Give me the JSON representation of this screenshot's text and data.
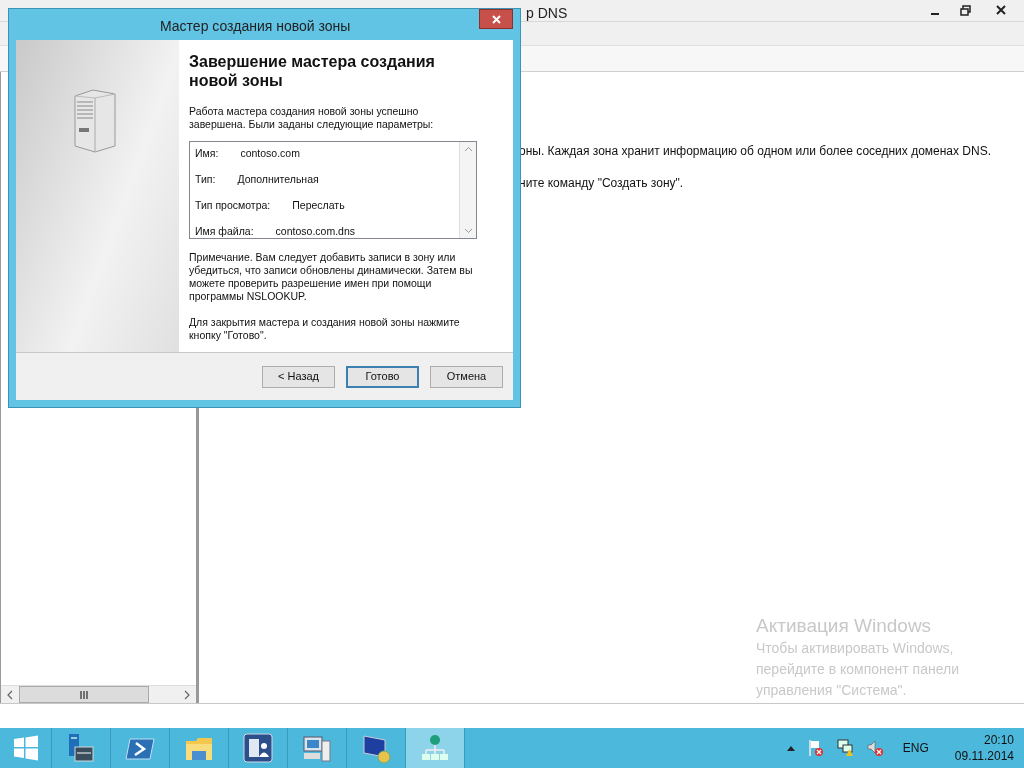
{
  "background_window": {
    "title": "р DNS",
    "description_lines": [
      "оны. Каждая зона хранит информацию об одном или более соседних доменах DNS.",
      "ните команду \"Создать зону\"."
    ]
  },
  "dialog": {
    "title": "Мастер создания новой зоны",
    "heading": "Завершение мастера создания новой зоны",
    "intro": "Работа мастера создания новой зоны успешно завершена. Были заданы следующие параметры:",
    "summary": [
      {
        "label": "Имя:",
        "value": "contoso.com"
      },
      {
        "label": "Тип:",
        "value": "Дополнительная"
      },
      {
        "label": "Тип просмотра:",
        "value": "Переслать"
      },
      {
        "label": "Имя файла:",
        "value": "contoso.com.dns"
      }
    ],
    "note": "Примечание. Вам следует добавить записи в зону или убедиться, что записи обновлены динамически. Затем вы можете проверить разрешение имен при помощи программы NSLOOKUP.",
    "closing": "Для закрытия мастера и создания новой зоны нажмите кнопку \"Готово\".",
    "buttons": [
      {
        "label": "< Назад",
        "default": false
      },
      {
        "label": "Готово",
        "default": true
      },
      {
        "label": "Отмена",
        "default": false
      }
    ]
  },
  "activation": {
    "title": "Активация Windows",
    "lines": [
      "Чтобы активировать Windows,",
      "перейдите в компонент панели",
      "управления \"Система\"."
    ]
  },
  "taskbar": {
    "apps": [
      {
        "kind": "server",
        "selected": false
      },
      {
        "kind": "powershell",
        "selected": false
      },
      {
        "kind": "folder",
        "selected": false
      },
      {
        "kind": "building",
        "selected": false
      },
      {
        "kind": "computer",
        "selected": false
      },
      {
        "kind": "remote",
        "selected": false
      },
      {
        "kind": "network",
        "selected": true
      }
    ],
    "language": "ENG",
    "time": "20:10",
    "date": "09.11.2014"
  }
}
